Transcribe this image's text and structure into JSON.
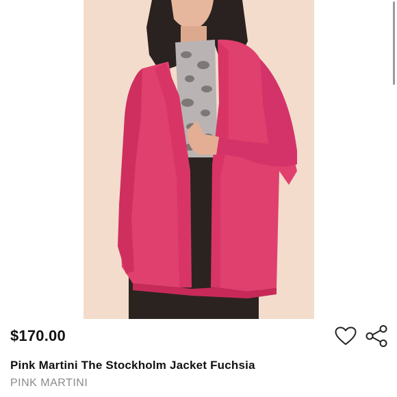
{
  "listing": {
    "price": "$170.00",
    "title": "Pink Martini The Stockholm Jacket Fuchsia",
    "brand": "PINK MARTINI",
    "image_subject": "model wearing fuchsia open-front jacket over snakeskin print top",
    "icons": [
      "heart-icon",
      "share-icon"
    ]
  },
  "colors": {
    "jacket": "#e0406e",
    "photo_background": "#f3dccb",
    "price_text": "#111111",
    "brand_text": "#8a8a8a"
  }
}
